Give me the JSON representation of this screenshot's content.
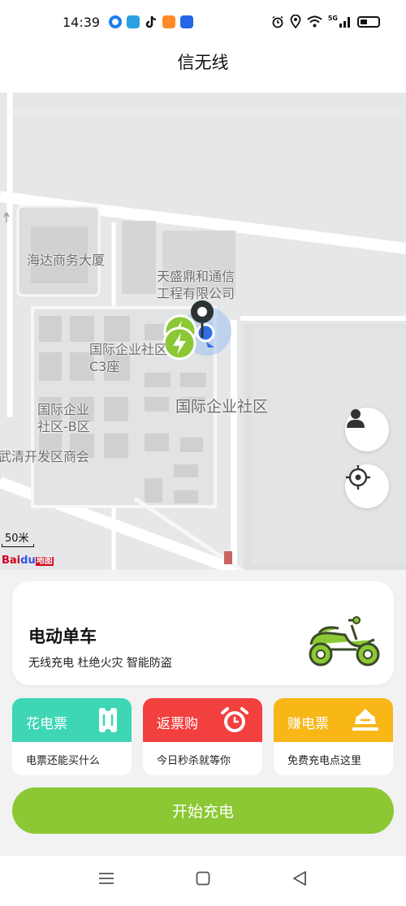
{
  "status_bar": {
    "time": "14:39",
    "app_icons": [
      "maps-app-icon",
      "telegram-app-icon",
      "tiktok-app-icon",
      "running-app-icon",
      "translate-app-icon"
    ],
    "indicators": [
      "alarm-icon",
      "location-icon",
      "wifi-icon",
      "signal-icon",
      "battery-icon"
    ],
    "signal_label": "5G"
  },
  "header": {
    "title": "信无线"
  },
  "map": {
    "labels": {
      "haida": "海达商务大厦",
      "tiansheng_1": "天盛鼎和通信",
      "tiansheng_2": "工程有限公司",
      "guoji_c3_1": "国际企业社区",
      "guoji_c3_2": "C3座",
      "guoji_main": "国际企业社区",
      "guoji_b_1": "国际企业",
      "guoji_b_2": "社区-B区",
      "wuqing": "武清开发区商会"
    },
    "scale": "50米",
    "provider_logo_a": "Bai",
    "provider_logo_b": "du",
    "provider_logo_c": "地图"
  },
  "product_card": {
    "title": "电动单车",
    "subtitle": "无线充电 杜绝火灾 智能防盗"
  },
  "tiles": [
    {
      "title": "花电票",
      "subtitle": "电票还能买什么",
      "color": "#3ed6b4",
      "icon": "ticket-icon"
    },
    {
      "title": "返票购",
      "subtitle": "今日秒杀就等你",
      "color": "#f2403f",
      "icon": "alarm-clock-icon"
    },
    {
      "title": "赚电票",
      "subtitle": "免费充电点这里",
      "color": "#f8b617",
      "icon": "tickets-stack-icon"
    }
  ],
  "start_button": {
    "label": "开始充电"
  },
  "colors": {
    "accent_green": "#8bc833",
    "location_blue": "#2f6ee6"
  }
}
